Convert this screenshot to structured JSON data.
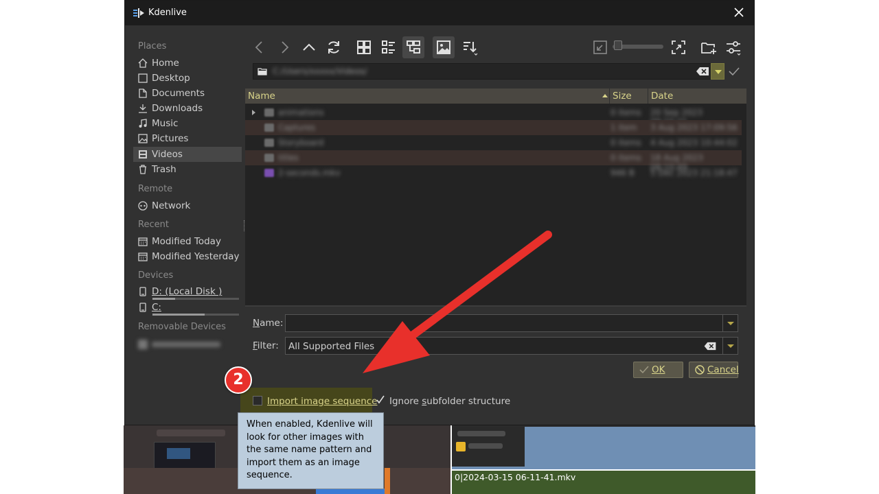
{
  "window": {
    "title": "Kdenlive",
    "colors": {
      "titlebar": "#1c1c1c",
      "dialog": "#313131",
      "accent_text": "#d9d48a",
      "tooltip_bg": "#bccddd"
    }
  },
  "sidebar": {
    "sections": {
      "places": "Places",
      "remote": "Remote",
      "recent": "Recent",
      "devices": "Devices",
      "removable": "Removable Devices"
    },
    "places": [
      {
        "label": "Home",
        "icon": "home-icon"
      },
      {
        "label": "Desktop",
        "icon": "desktop-icon"
      },
      {
        "label": "Documents",
        "icon": "documents-icon"
      },
      {
        "label": "Downloads",
        "icon": "download-icon"
      },
      {
        "label": "Music",
        "icon": "music-icon"
      },
      {
        "label": "Pictures",
        "icon": "pictures-icon"
      },
      {
        "label": "Videos",
        "icon": "videos-icon",
        "selected": true
      },
      {
        "label": "Trash",
        "icon": "trash-icon"
      }
    ],
    "remote": [
      {
        "label": "Network",
        "icon": "network-icon"
      }
    ],
    "recent": [
      {
        "label": "Modified Today",
        "icon": "calendar-icon"
      },
      {
        "label": "Modified Yesterday",
        "icon": "calendar-icon"
      }
    ],
    "devices": [
      {
        "label": "D: (Local Disk )",
        "icon": "drive-icon",
        "usage": 0.26
      },
      {
        "label": "C:",
        "icon": "drive-icon",
        "usage": 0.6
      }
    ]
  },
  "file_list": {
    "columns": {
      "name": "Name",
      "size": "Size",
      "date": "Date"
    }
  },
  "form": {
    "name_label": "ame:",
    "name_mnemonic": "N",
    "name_value": "",
    "filter_label": "ilter:",
    "filter_mnemonic": "F",
    "filter_value": "All Supported Files"
  },
  "buttons": {
    "ok_label": "OK",
    "cancel_label": "Cancel"
  },
  "options": {
    "import_sequence_label": "Import image sequence",
    "import_sequence_checked": false,
    "ignore_subfolder_pre": "Ignore ",
    "ignore_subfolder_mnemonic": "s",
    "ignore_subfolder_post": "ubfolder structure",
    "ignore_subfolder_checked": true
  },
  "tooltip": {
    "text": "When enabled, Kdenlive will look for other images with the same name pattern and import them as an image sequence."
  },
  "annotation": {
    "step_number": "2"
  },
  "background": {
    "clip_label": "0|2024-03-15 06-11-41.mkv"
  }
}
